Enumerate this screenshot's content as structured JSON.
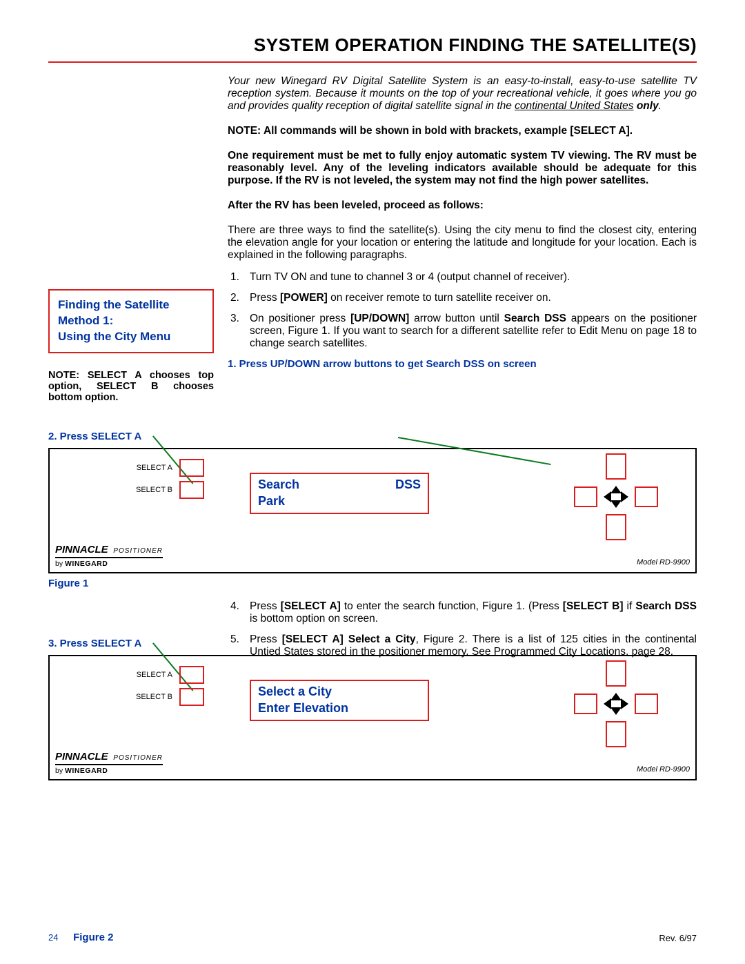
{
  "title": "SYSTEM OPERATION FINDING THE SATELLITE(S)",
  "intro": {
    "prefix": "Your new Winegard RV Digital Satellite System is an easy-to-install, easy-to-use satellite TV reception system. Because it mounts on the top of your recreational vehicle, it goes where you go and provides quality reception of digital satellite signal in the ",
    "underline": "continental United States",
    "only": " only",
    "suffix": "."
  },
  "note1": "NOTE: All commands will be shown in bold with brackets, example [SELECT A].",
  "req": "One requirement must be met to fully enjoy automatic system TV viewing. The RV must be reasonably level. Any of the leveling indicators available should be adequate for this purpose. If the RV is not leveled, the system may not find the high power satellites.",
  "after": "After the RV has been leveled, proceed as follows:",
  "method_box": {
    "l1": "Finding the Satellite",
    "l2": "Method 1:",
    "l3": "Using the City Menu"
  },
  "left_note": "NOTE: SELECT A chooses top option, SELECT B chooses bottom option.",
  "left_step2": "2. Press SELECT A",
  "left_step3": "3. Press SELECT A",
  "fig1": "Figure 1",
  "fig2": "Figure 2",
  "three_ways": "There are three ways to find the satellite(s). Using the city menu to find the closest city, entering the elevation angle for your location or entering the latitude and longitude for your location. Each is explained in the following paragraphs.",
  "steps": {
    "s1": "Turn TV ON and tune to channel 3 or 4 (output channel of receiver).",
    "s2_a": "Press ",
    "s2_b": "[POWER]",
    "s2_c": " on receiver remote to turn satellite receiver on.",
    "s3_a": "On positioner press ",
    "s3_b": "[UP/DOWN]",
    "s3_c": " arrow button until ",
    "s3_d": "Search  DSS",
    "s3_e": " appears on the positioner screen, Figure 1. If you want to search for a different satellite refer to Edit Menu on page 18 to change search satellites.",
    "cap1": "1.  Press UP/DOWN arrow buttons to get Search  DSS on screen",
    "s4_a": "Press ",
    "s4_b": "[SELECT A]",
    "s4_c": " to enter the search function, Figure 1. (Press ",
    "s4_d": "[SELECT B]",
    "s4_e": " if ",
    "s4_f": "Search  DSS",
    "s4_g": " is bottom option on screen.",
    "s5_a": "Press ",
    "s5_b": "[SELECT A] Select a City",
    "s5_c": ", Figure 2. There is a list of 125 cities in the continental Untied States stored in the positioner memory. See Programmed City Locations, page 28."
  },
  "panel": {
    "selectA": "SELECT A",
    "selectB": "SELECT B",
    "pinnacle": "PINNACLE",
    "positioner": "POSITIONER",
    "by": "by ",
    "winegard": "WINEGARD",
    "model": "Model RD-9900"
  },
  "screen1": {
    "l1a": "Search",
    "l1b": "DSS",
    "l2": "Park"
  },
  "screen2": {
    "l1": "Select a City",
    "l2": "Enter Elevation"
  },
  "footer": {
    "page": "24",
    "rev": "Rev. 6/97"
  }
}
